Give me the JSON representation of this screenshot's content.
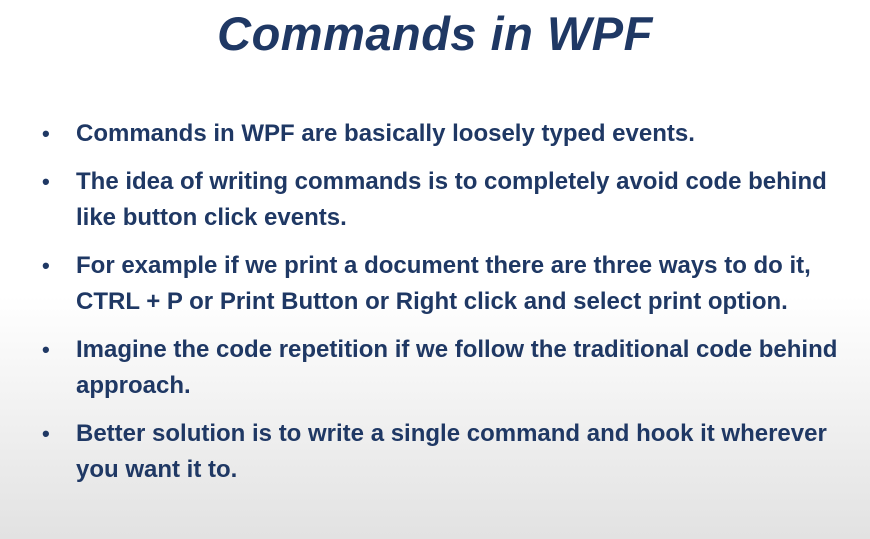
{
  "slide": {
    "title": "Commands in WPF",
    "bullet_glyph": "•",
    "bullets": [
      "Commands in WPF are basically loosely typed events.",
      "The idea of writing commands is to completely avoid code behind like button click events.",
      "For example if we print a document there are three ways to do it, CTRL + P or Print Button or Right click and select print option.",
      "Imagine the code repetition if we follow the traditional code behind approach.",
      "Better solution is to write a single command and hook it wherever you want it to."
    ]
  },
  "colors": {
    "text": "#1f3864",
    "background_top": "#ffffff",
    "background_bottom": "#e2e2e2"
  }
}
